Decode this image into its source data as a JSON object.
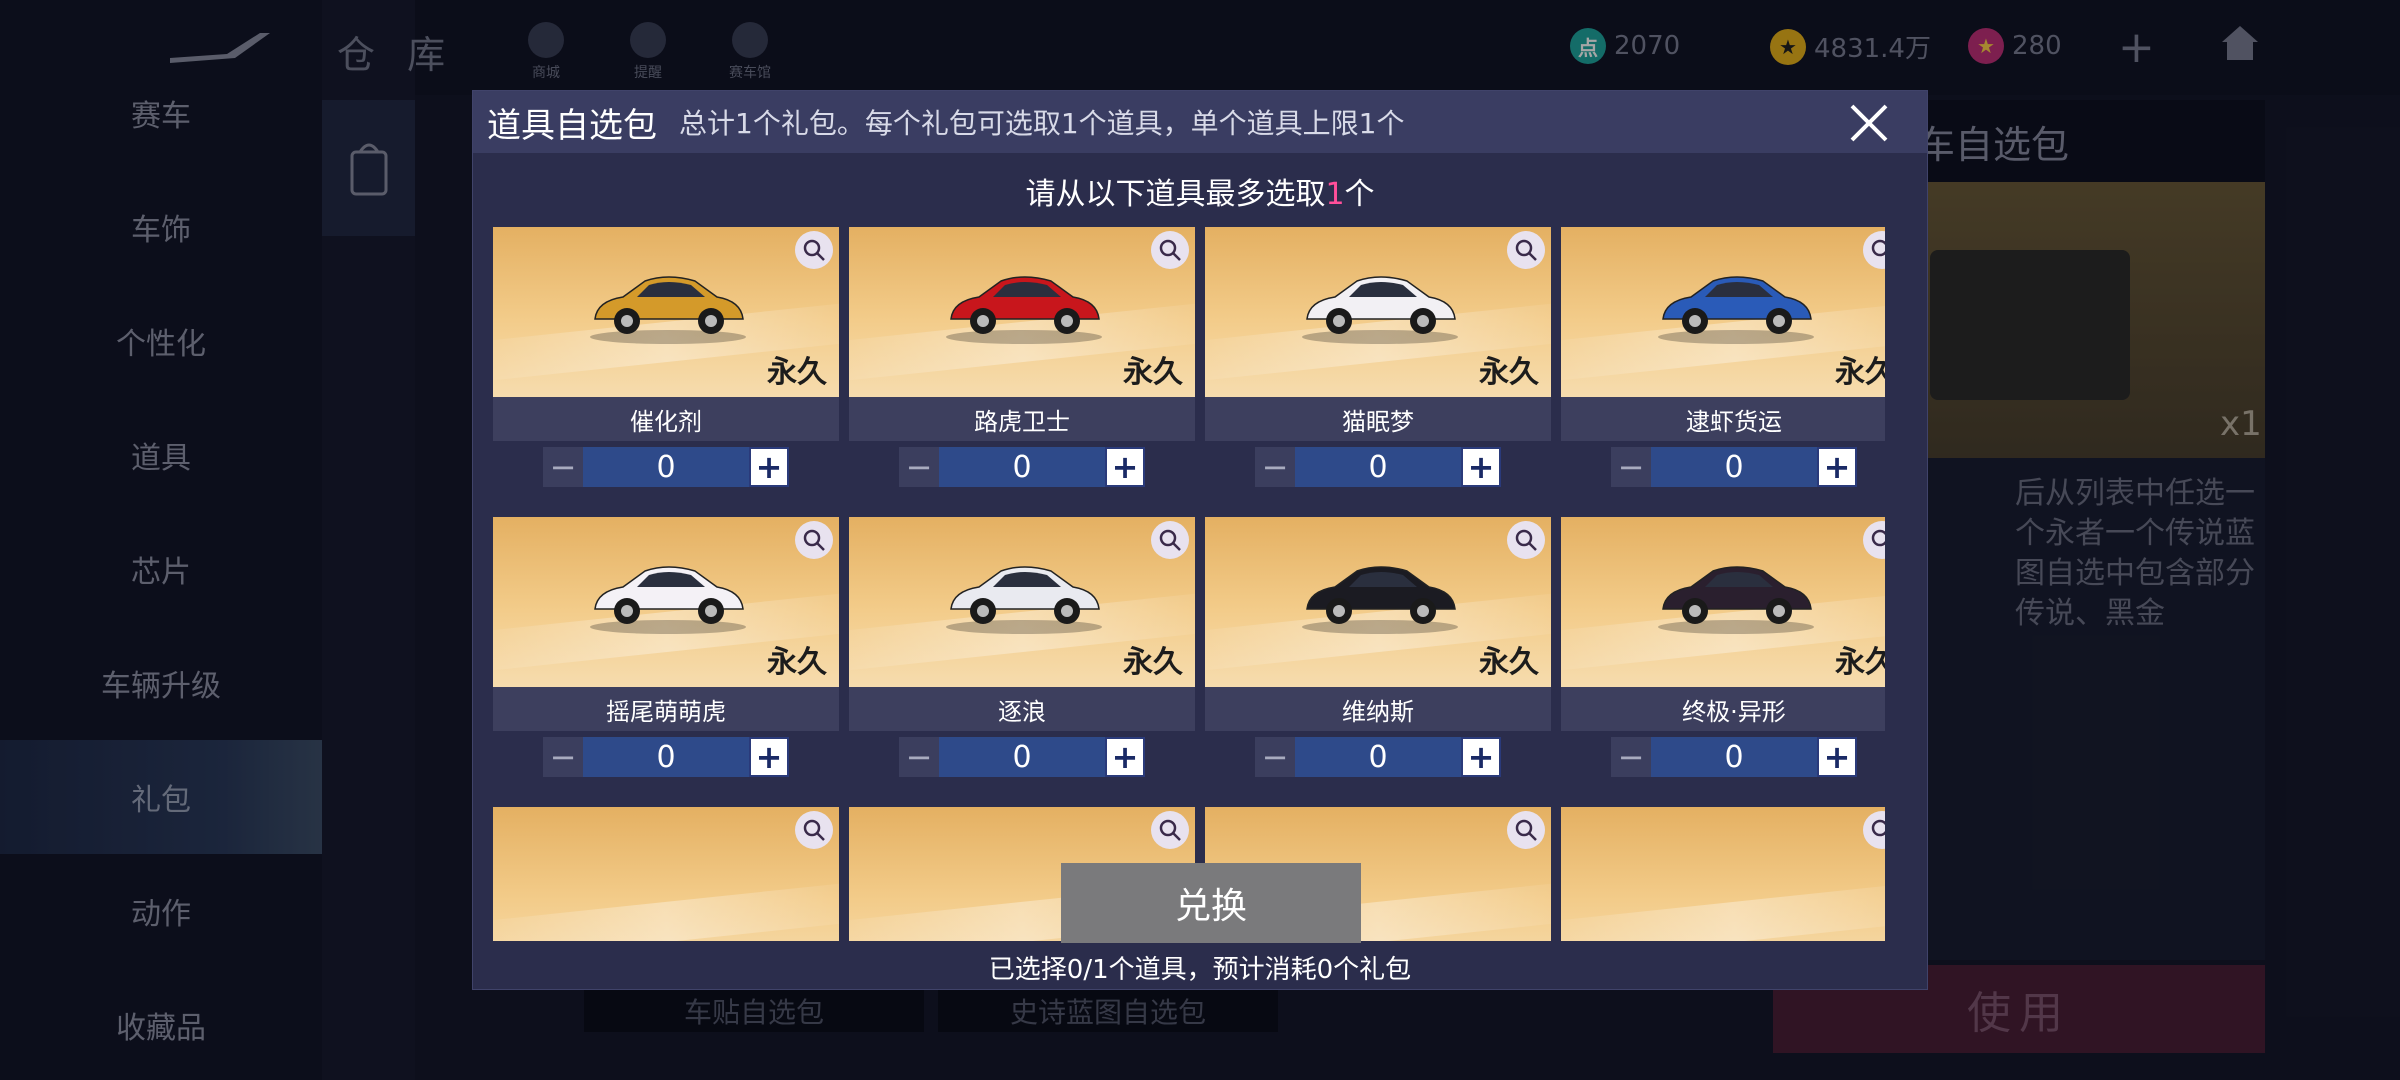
{
  "background": {
    "title": "仓 库",
    "sidebar": [
      "赛车",
      "车饰",
      "个性化",
      "道具",
      "芯片",
      "车辆升级",
      "礼包",
      "动作",
      "收藏品"
    ],
    "sidebar_active_index": 6,
    "top_icons": [
      "商城",
      "提醒",
      "赛车馆"
    ],
    "currencies": [
      {
        "icon": "coupon-icon",
        "value": "2070",
        "color": "#1fa6a0"
      },
      {
        "icon": "coin-icon",
        "value": "4831.4万",
        "color": "#e8b21c"
      },
      {
        "icon": "star-gem-icon",
        "value": "280",
        "color": "#c0307a"
      }
    ],
    "panel_title": "供传说车自选包",
    "panel_qty": "x1",
    "panel_desc": "后从列表中任选一个永者一个传说蓝图自选中包含部分传说、黑金",
    "use_label": "使用",
    "packs": [
      "车贴自选包",
      "史诗蓝图自选包"
    ]
  },
  "modal": {
    "title": "道具自选包",
    "subtitle": "总计1个礼包。每个礼包可选取1个道具，单个道具上限1个",
    "prompt_before": "请从以下道具最多选取",
    "prompt_count": "1",
    "prompt_after": "个",
    "items": [
      {
        "name": "催化剂",
        "tag": "永久",
        "qty": "0",
        "car_color": "#d49a2a"
      },
      {
        "name": "路虎卫士",
        "tag": "永久",
        "qty": "0",
        "car_color": "#c8161c"
      },
      {
        "name": "猫眠梦",
        "tag": "永久",
        "qty": "0",
        "car_color": "#f2f0f4"
      },
      {
        "name": "逮虾货运",
        "tag": "永久",
        "qty": "0",
        "car_color": "#2a5bb8"
      },
      {
        "name": "摇尾萌萌虎",
        "tag": "永久",
        "qty": "0",
        "car_color": "#f4f1f6"
      },
      {
        "name": "逐浪",
        "tag": "永久",
        "qty": "0",
        "car_color": "#e9eaf0"
      },
      {
        "name": "维纳斯",
        "tag": "永久",
        "qty": "0",
        "car_color": "#1b1b22"
      },
      {
        "name": "终极·异形",
        "tag": "永久",
        "qty": "0",
        "car_color": "#2a1f2e"
      },
      {
        "name": "",
        "tag": "",
        "qty": "",
        "car_color": ""
      },
      {
        "name": "",
        "tag": "",
        "qty": "",
        "car_color": ""
      },
      {
        "name": "",
        "tag": "",
        "qty": "",
        "car_color": ""
      },
      {
        "name": "",
        "tag": "",
        "qty": "",
        "car_color": ""
      }
    ],
    "exchange_label": "兑换",
    "footer_note": "已选择0/1个道具，预计消耗0个礼包"
  }
}
